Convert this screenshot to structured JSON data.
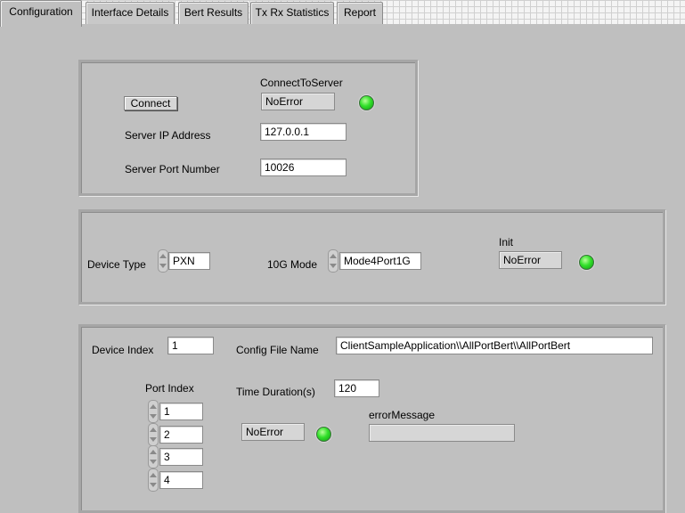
{
  "tabs": [
    {
      "label": "Configuration",
      "active": true
    },
    {
      "label": "Interface Details",
      "active": false
    },
    {
      "label": "Bert Results",
      "active": false
    },
    {
      "label": "Tx Rx Statistics",
      "active": false
    },
    {
      "label": "Report",
      "active": false
    }
  ],
  "server": {
    "connect_button": "Connect",
    "status_label": "ConnectToServer",
    "status_value": "NoError",
    "status_led": "green",
    "ip_label": "Server IP Address",
    "ip_value": "127.0.0.1",
    "port_label": "Server Port  Number",
    "port_value": "10026"
  },
  "device": {
    "type_label": "Device Type",
    "type_value": "PXN",
    "mode_label": "10G Mode",
    "mode_value": "Mode4Port1G",
    "init_label": "Init",
    "init_value": "NoError",
    "init_led": "green"
  },
  "test": {
    "device_index_label": "Device Index",
    "device_index_value": "1",
    "config_file_label": "Config File Name",
    "config_file_value": "ClientSampleApplication\\\\AllPortBert\\\\AllPortBert",
    "port_index_label": "Port Index",
    "port_index_values": [
      "1",
      "2",
      "3",
      "4"
    ],
    "time_duration_label": "Time Duration(s)",
    "time_duration_value": "120",
    "status_value": "NoError",
    "status_led": "green",
    "error_message_label": "errorMessage",
    "error_message_value": ""
  }
}
